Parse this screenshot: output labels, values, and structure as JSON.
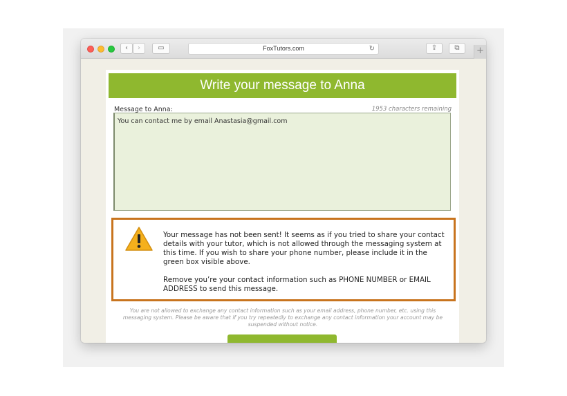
{
  "browser": {
    "url": "FoxTutors.com",
    "icons": {
      "back": "chevron-left-icon",
      "forward": "chevron-right-icon",
      "sidebar": "sidebar-icon",
      "share": "share-icon",
      "tabs": "tabs-icon",
      "reload": "reload-icon",
      "new_tab": "plus-icon"
    },
    "glyphs": {
      "back": "‹",
      "forward": "›",
      "sidebar": "▭",
      "share": "⇪",
      "tabs": "⧉",
      "reload": "↻",
      "new_tab": "+"
    }
  },
  "page": {
    "title": "Write your message to Anna",
    "message_label": "Message to Anna:",
    "chars_remaining": "1953 characters remaining",
    "message_text": "You can contact me by email Anastasia@gmail.com",
    "warning": {
      "icon": "warning-icon",
      "paragraph1": "Your message has not been sent! It seems as if you tried to share your contact details with your tutor, which is not allowed through the messaging system at this time. If you wish to share your phone number, please include it in the green box visible above.",
      "paragraph2": "Remove you’re your contact information such as PHONE NUMBER or EMAIL ADDRESS to send this message."
    },
    "disclaimer": "You are not allowed to exchange any contact information such as your email address, phone number, etc. using this messaging system. Please be aware that if you try repeatedly to exchange any contact information your account may be suspended without notice."
  },
  "colors": {
    "brand_green": "#8fb82f",
    "message_box_bg": "#eaf1dc",
    "warning_border": "#c8741e",
    "warning_icon": "#f5b01c"
  }
}
